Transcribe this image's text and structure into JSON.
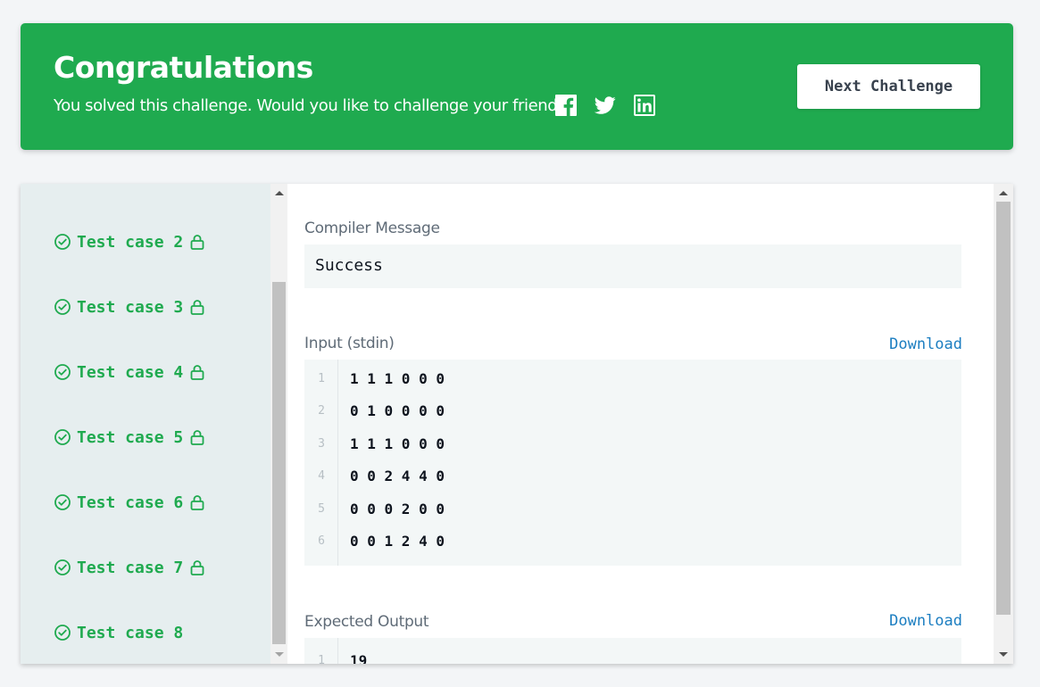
{
  "banner": {
    "title": "Congratulations",
    "subtitle": "You solved this challenge. Would you like to challenge your friends?",
    "share_icons": [
      "facebook-icon",
      "twitter-icon",
      "linkedin-icon"
    ],
    "next_button": "Next Challenge",
    "background_color": "#1faa4f"
  },
  "sidebar": {
    "test_cases": [
      {
        "label": "Test case 2",
        "status": "passed",
        "locked": true
      },
      {
        "label": "Test case 3",
        "status": "passed",
        "locked": true
      },
      {
        "label": "Test case 4",
        "status": "passed",
        "locked": true
      },
      {
        "label": "Test case 5",
        "status": "passed",
        "locked": true
      },
      {
        "label": "Test case 6",
        "status": "passed",
        "locked": true
      },
      {
        "label": "Test case 7",
        "status": "passed",
        "locked": true
      },
      {
        "label": "Test case 8",
        "status": "passed",
        "locked": false
      }
    ],
    "accent_color": "#1faa4f"
  },
  "content": {
    "compiler_label": "Compiler Message",
    "compiler_message": "Success",
    "input_label": "Input (stdin)",
    "input_download": "Download",
    "input_lines": [
      {
        "n": "1",
        "text": "1 1 1 0 0 0"
      },
      {
        "n": "2",
        "text": "0 1 0 0 0 0"
      },
      {
        "n": "3",
        "text": "1 1 1 0 0 0"
      },
      {
        "n": "4",
        "text": "0 0 2 4 4 0"
      },
      {
        "n": "5",
        "text": "0 0 0 2 0 0"
      },
      {
        "n": "6",
        "text": "0 0 1 2 4 0"
      }
    ],
    "output_label": "Expected Output",
    "output_download": "Download",
    "output_lines": [
      {
        "n": "1",
        "text": "19"
      }
    ],
    "link_color": "#1c7ec1"
  }
}
